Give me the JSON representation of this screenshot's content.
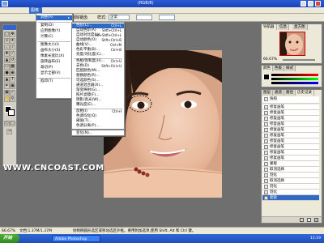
{
  "menubar": {
    "items": [
      "模式(M)",
      "调整(A)",
      "复制(D)",
      "应用图像(Y)"
    ],
    "active_index": 0
  },
  "options_bar": {
    "segment1": "消除锯齿",
    "style_label": "样式:",
    "style_value": "正常"
  },
  "title_suffix": "(RGB/8)",
  "mode_menu": {
    "items": [
      {
        "label": "调整(A)",
        "highlight": true
      },
      {
        "label": "复制(D)"
      },
      {
        "label": "应用图像(Y)"
      },
      {
        "label": "计算(C)"
      },
      {
        "label": "图像大小(I)"
      },
      {
        "label": "画布大小(S)"
      },
      {
        "label": "像素长宽比(X)"
      },
      {
        "label": "旋转画布(E)"
      },
      {
        "label": "裁切(P)"
      },
      {
        "label": "显示全部(V)"
      },
      {
        "label": "陷印(T)"
      }
    ]
  },
  "adjust_menu": {
    "items": [
      {
        "label": "色阶(L)...",
        "shortcut": "Ctrl+L",
        "highlight": true
      },
      {
        "label": "自动色阶(A)",
        "shortcut": "Shft+Ctrl+L"
      },
      {
        "label": "自动对比度(U)",
        "shortcut": "Alt+Shft+Ctrl+L"
      },
      {
        "label": "自动颜色(O)",
        "shortcut": "Shft+Ctrl+B"
      },
      {
        "label": "曲线(V)...",
        "shortcut": "Ctrl+M"
      },
      {
        "label": "色彩平衡(B)...",
        "shortcut": "Ctrl+B"
      },
      {
        "label": "亮度/对比度(C)..."
      },
      {
        "label": "色相/饱和度(H)...",
        "shortcut": "Ctrl+U"
      },
      {
        "label": "去色(D)",
        "shortcut": "Shft+Ctrl+U"
      },
      {
        "label": "匹配颜色(M)..."
      },
      {
        "label": "替换颜色(R)..."
      },
      {
        "label": "可选颜色(S)..."
      },
      {
        "label": "通道混合器(X)..."
      },
      {
        "label": "渐变映射(G)..."
      },
      {
        "label": "照片滤镜(F)..."
      },
      {
        "label": "阴影/高光(W)..."
      },
      {
        "label": "曝光度(E)..."
      },
      {
        "label": "反相(I)",
        "shortcut": "Ctrl+I"
      },
      {
        "label": "色调均化(Q)"
      },
      {
        "label": "阈值(T)..."
      },
      {
        "label": "色调分离(P)..."
      },
      {
        "label": "变化(N)..."
      }
    ]
  },
  "navigator": {
    "tabs": [
      "导航器",
      "信息",
      "直方图"
    ],
    "zoom": "66.67%"
  },
  "color_panel": {
    "tabs": [
      "颜色",
      "色板",
      "样式"
    ]
  },
  "history": {
    "tabs": [
      "图层",
      "通道",
      "路径",
      "历史记录"
    ],
    "rows": [
      {
        "label": "快照"
      },
      {
        "label": "修复画笔"
      },
      {
        "label": "修复画笔"
      },
      {
        "label": "修复画笔"
      },
      {
        "label": "修复画笔"
      },
      {
        "label": "修复画笔"
      },
      {
        "label": "修复画笔"
      },
      {
        "label": "修复画笔"
      },
      {
        "label": "修复画笔"
      },
      {
        "label": "修复画笔"
      },
      {
        "label": "修复画笔"
      },
      {
        "label": "蒙版"
      },
      {
        "label": "取消选择"
      },
      {
        "label": "羽化"
      },
      {
        "label": "取消选择"
      },
      {
        "label": "羽化"
      },
      {
        "label": "羽化"
      },
      {
        "label": "套索",
        "highlight": true
      }
    ]
  },
  "status": {
    "zoom": "66.67%",
    "doc": "文档:1.37M/1.37M",
    "hint": "绘制椭圆形选区或移动选区外框。要用附加选项,使用 Shift, Alt 和 Ctrl 键。"
  },
  "taskbar": {
    "start_label": "开始",
    "task1": "Adobe Photoshop",
    "clock": "11:19"
  },
  "watermark": "WWW.CNCOAST.COM"
}
